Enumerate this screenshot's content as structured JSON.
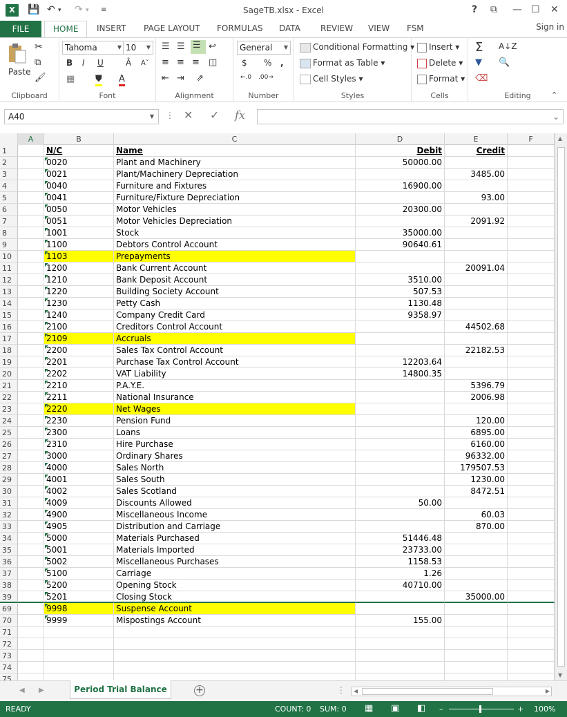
{
  "window": {
    "title": "SageTB.xlsx - Excel",
    "help": "?",
    "buttons": [
      "?",
      "⧉",
      "—",
      "☐",
      "✕"
    ]
  },
  "ribbon_tabs": [
    "FILE",
    "HOME",
    "INSERT",
    "PAGE LAYOUT",
    "FORMULAS",
    "DATA",
    "REVIEW",
    "VIEW",
    "FSM"
  ],
  "sign_in": "Sign in",
  "clipboard": {
    "paste": "Paste",
    "label": "Clipboard"
  },
  "font": {
    "name": "Tahoma",
    "size": "10",
    "label": "Font",
    "bold": "B",
    "italic": "I",
    "underline": "U"
  },
  "alignment": {
    "label": "Alignment"
  },
  "number": {
    "format": "General",
    "label": "Number",
    "currency": "$",
    "percent": "%",
    "comma": ","
  },
  "styles": {
    "label": "Styles",
    "conditional": "Conditional Formatting",
    "format_table": "Format as Table",
    "cell_styles": "Cell Styles"
  },
  "cells": {
    "label": "Cells",
    "insert": "Insert",
    "delete": "Delete",
    "format": "Format"
  },
  "editing": {
    "label": "Editing"
  },
  "name_box": "A40",
  "columns": [
    "A",
    "B",
    "C",
    "D",
    "E",
    "F"
  ],
  "rows": [
    {
      "n": "1",
      "b": "N/C",
      "c": "Name",
      "d": "Debit",
      "e": "Credit",
      "hdr": true
    },
    {
      "n": "2",
      "b": "0020",
      "c": "Plant and Machinery",
      "d": "50000.00",
      "e": ""
    },
    {
      "n": "3",
      "b": "0021",
      "c": "Plant/Machinery Depreciation",
      "d": "",
      "e": "3485.00"
    },
    {
      "n": "4",
      "b": "0040",
      "c": "Furniture and Fixtures",
      "d": "16900.00",
      "e": ""
    },
    {
      "n": "5",
      "b": "0041",
      "c": "Furniture/Fixture Depreciation",
      "d": "",
      "e": "93.00"
    },
    {
      "n": "6",
      "b": "0050",
      "c": "Motor Vehicles",
      "d": "20300.00",
      "e": ""
    },
    {
      "n": "7",
      "b": "0051",
      "c": "Motor Vehicles Depreciation",
      "d": "",
      "e": "2091.92"
    },
    {
      "n": "8",
      "b": "1001",
      "c": "Stock",
      "d": "35000.00",
      "e": ""
    },
    {
      "n": "9",
      "b": "1100",
      "c": "Debtors Control Account",
      "d": "90640.61",
      "e": ""
    },
    {
      "n": "10",
      "b": "1103",
      "c": "Prepayments",
      "d": "",
      "e": "",
      "hl": true
    },
    {
      "n": "11",
      "b": "1200",
      "c": "Bank Current Account",
      "d": "",
      "e": "20091.04"
    },
    {
      "n": "12",
      "b": "1210",
      "c": "Bank Deposit Account",
      "d": "3510.00",
      "e": ""
    },
    {
      "n": "13",
      "b": "1220",
      "c": "Building Society Account",
      "d": "507.53",
      "e": ""
    },
    {
      "n": "14",
      "b": "1230",
      "c": "Petty Cash",
      "d": "1130.48",
      "e": ""
    },
    {
      "n": "15",
      "b": "1240",
      "c": "Company Credit Card",
      "d": "9358.97",
      "e": ""
    },
    {
      "n": "16",
      "b": "2100",
      "c": "Creditors Control Account",
      "d": "",
      "e": "44502.68"
    },
    {
      "n": "17",
      "b": "2109",
      "c": "Accruals",
      "d": "",
      "e": "",
      "hl": true
    },
    {
      "n": "18",
      "b": "2200",
      "c": "Sales Tax Control Account",
      "d": "",
      "e": "22182.53"
    },
    {
      "n": "19",
      "b": "2201",
      "c": "Purchase Tax Control Account",
      "d": "12203.64",
      "e": ""
    },
    {
      "n": "20",
      "b": "2202",
      "c": "VAT Liability",
      "d": "14800.35",
      "e": ""
    },
    {
      "n": "21",
      "b": "2210",
      "c": "P.A.Y.E.",
      "d": "",
      "e": "5396.79"
    },
    {
      "n": "22",
      "b": "2211",
      "c": "National Insurance",
      "d": "",
      "e": "2006.98"
    },
    {
      "n": "23",
      "b": "2220",
      "c": "Net Wages",
      "d": "",
      "e": "",
      "hl": true
    },
    {
      "n": "24",
      "b": "2230",
      "c": "Pension Fund",
      "d": "",
      "e": "120.00"
    },
    {
      "n": "25",
      "b": "2300",
      "c": "Loans",
      "d": "",
      "e": "6895.00"
    },
    {
      "n": "26",
      "b": "2310",
      "c": "Hire Purchase",
      "d": "",
      "e": "6160.00"
    },
    {
      "n": "27",
      "b": "3000",
      "c": "Ordinary Shares",
      "d": "",
      "e": "96332.00"
    },
    {
      "n": "28",
      "b": "4000",
      "c": "Sales North",
      "d": "",
      "e": "179507.53"
    },
    {
      "n": "29",
      "b": "4001",
      "c": "Sales South",
      "d": "",
      "e": "1230.00"
    },
    {
      "n": "30",
      "b": "4002",
      "c": "Sales Scotland",
      "d": "",
      "e": "8472.51"
    },
    {
      "n": "31",
      "b": "4009",
      "c": "Discounts Allowed",
      "d": "50.00",
      "e": ""
    },
    {
      "n": "32",
      "b": "4900",
      "c": "Miscellaneous Income",
      "d": "",
      "e": "60.03"
    },
    {
      "n": "33",
      "b": "4905",
      "c": "Distribution and Carriage",
      "d": "",
      "e": "870.00"
    },
    {
      "n": "34",
      "b": "5000",
      "c": "Materials Purchased",
      "d": "51446.48",
      "e": ""
    },
    {
      "n": "35",
      "b": "5001",
      "c": "Materials Imported",
      "d": "23733.00",
      "e": ""
    },
    {
      "n": "36",
      "b": "5002",
      "c": "Miscellaneous Purchases",
      "d": "1158.53",
      "e": ""
    },
    {
      "n": "37",
      "b": "5100",
      "c": "Carriage",
      "d": "1.26",
      "e": ""
    },
    {
      "n": "38",
      "b": "5200",
      "c": "Opening Stock",
      "d": "40710.00",
      "e": ""
    },
    {
      "n": "39",
      "b": "5201",
      "c": "Closing Stock",
      "d": "",
      "e": "35000.00",
      "frozen": true
    },
    {
      "n": "69",
      "b": "9998",
      "c": "Suspense Account",
      "d": "",
      "e": "",
      "hl": true
    },
    {
      "n": "70",
      "b": "9999",
      "c": "Mispostings Account",
      "d": "155.00",
      "e": ""
    },
    {
      "n": "71",
      "b": "",
      "c": "",
      "d": "",
      "e": ""
    },
    {
      "n": "72",
      "b": "",
      "c": "",
      "d": "",
      "e": ""
    },
    {
      "n": "73",
      "b": "",
      "c": "",
      "d": "",
      "e": ""
    },
    {
      "n": "74",
      "b": "",
      "c": "",
      "d": "",
      "e": ""
    },
    {
      "n": "75",
      "b": "",
      "c": "",
      "d": "",
      "e": ""
    }
  ],
  "sheet_tab": "Period Trial Balance",
  "status": {
    "ready": "READY",
    "count": "COUNT: 0",
    "sum": "SUM: 0",
    "zoom": "100%"
  },
  "colors": {
    "accent": "#217346",
    "highlight": "#ffff00"
  }
}
